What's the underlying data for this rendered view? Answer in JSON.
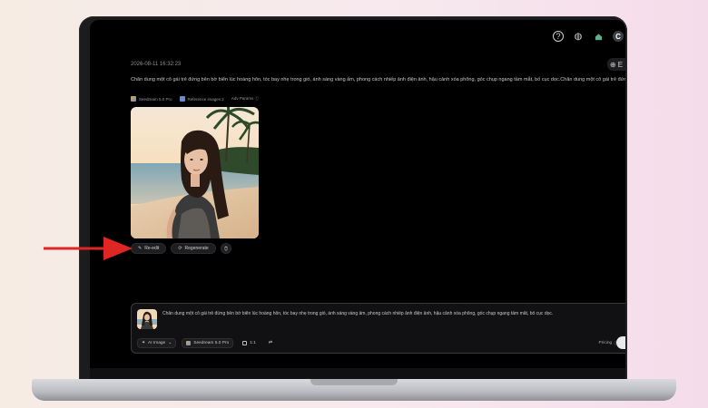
{
  "app": {
    "timestamp": "2026-08-11 16:32:23",
    "prompt": "Chân dung một cô gái trẻ đứng bên bờ biển lúc hoàng hôn, tóc bay nhẹ trong gió, ánh sáng vàng ấm, phong cách nhiếp ảnh điện ảnh, hậu cảnh xóa phông, góc chụp ngang tầm mắt, bố cục dọc.Chân dung một cô gái trẻ đứng bên bờ biển lúc hoàng hôn, tóc bay nhẹ trong gió, ánh sáng vàng ấm, phong cách nhiếp ảnh điện ảnh, hậu cảnh xóa phông, góc chụp ngang tầm mắt, bố cục dọc.",
    "meta": {
      "model": "Seedream 5.0 Pro",
      "reference": "Reference images 2",
      "params": "Adv Params ⓘ"
    },
    "actions": {
      "reedit": "Re-edit",
      "regenerate": "Regenerate"
    },
    "composer": {
      "text": "Chân dung một cô gái trẻ đứng bên bờ biển lúc hoàng hôn, tóc bay nhẹ trong gió, ánh sáng vàng ấm, phong cách nhiếp ảnh điện ảnh, hậu cảnh xóa phông, góc chụp ngang tầm mắt, bố cục dọc.",
      "mode": "AI Image",
      "model": "Seedream 5.0 Pro",
      "ratio": "1:1",
      "pricing": "Pricing"
    },
    "topbar": {
      "help_icon": "?",
      "globe_icon": "◍",
      "avatar": "C"
    },
    "zoom_label": "⊕ E"
  },
  "colors": {
    "annotation_arrow": "#e02525",
    "screen_bg": "#000000"
  }
}
